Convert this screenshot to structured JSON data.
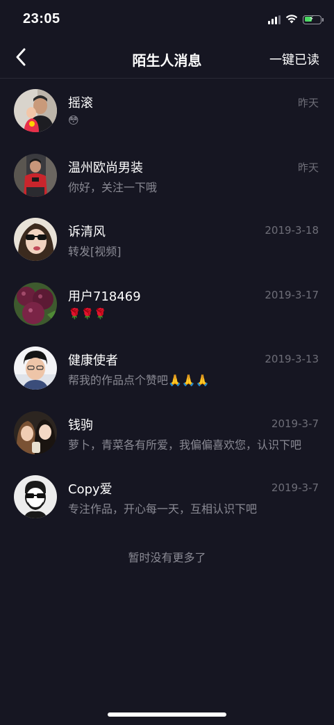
{
  "status_bar": {
    "time": "23:05",
    "icons": [
      "cellular-signal-icon",
      "wifi-icon",
      "battery-charging-icon"
    ],
    "battery_color": "#4cd964"
  },
  "nav": {
    "back_icon": "chevron-left-icon",
    "title": "陌生人消息",
    "mark_all_read": "一键已读"
  },
  "messages": [
    {
      "name": "摇滚",
      "time": "昨天",
      "preview": "😳",
      "avatar": "avatar-man-with-child"
    },
    {
      "name": "温州欧尚男装",
      "time": "昨天",
      "preview": "你好，关注一下哦",
      "avatar": "avatar-man-red-shirt"
    },
    {
      "name": "诉清风",
      "time": "2019-3-18",
      "preview": "转发[视频]",
      "avatar": "avatar-woman-sunglasses"
    },
    {
      "name": "用户718469",
      "time": "2019-3-17",
      "preview": "🌹🌹🌹",
      "avatar": "avatar-bayberries"
    },
    {
      "name": "健康使者",
      "time": "2019-3-13",
      "preview": "帮我的作品点个赞吧🙏🙏🙏",
      "avatar": "avatar-person-glasses"
    },
    {
      "name": "钱驹",
      "time": "2019-3-7",
      "preview": "萝卜，青菜各有所爱，我偏偏喜欢您，认识下吧",
      "avatar": "avatar-two-women"
    },
    {
      "name": "Copy爱",
      "time": "2019-3-7",
      "preview": "专注作品，开心每一天，互相认识下吧",
      "avatar": "avatar-cartoon-man-sunglasses"
    }
  ],
  "footer": {
    "no_more": "暂时没有更多了"
  },
  "colors": {
    "background": "#161622",
    "primary_text": "#ffffff",
    "secondary_text": "#8a8a94",
    "timestamp_text": "#6e6e78"
  }
}
